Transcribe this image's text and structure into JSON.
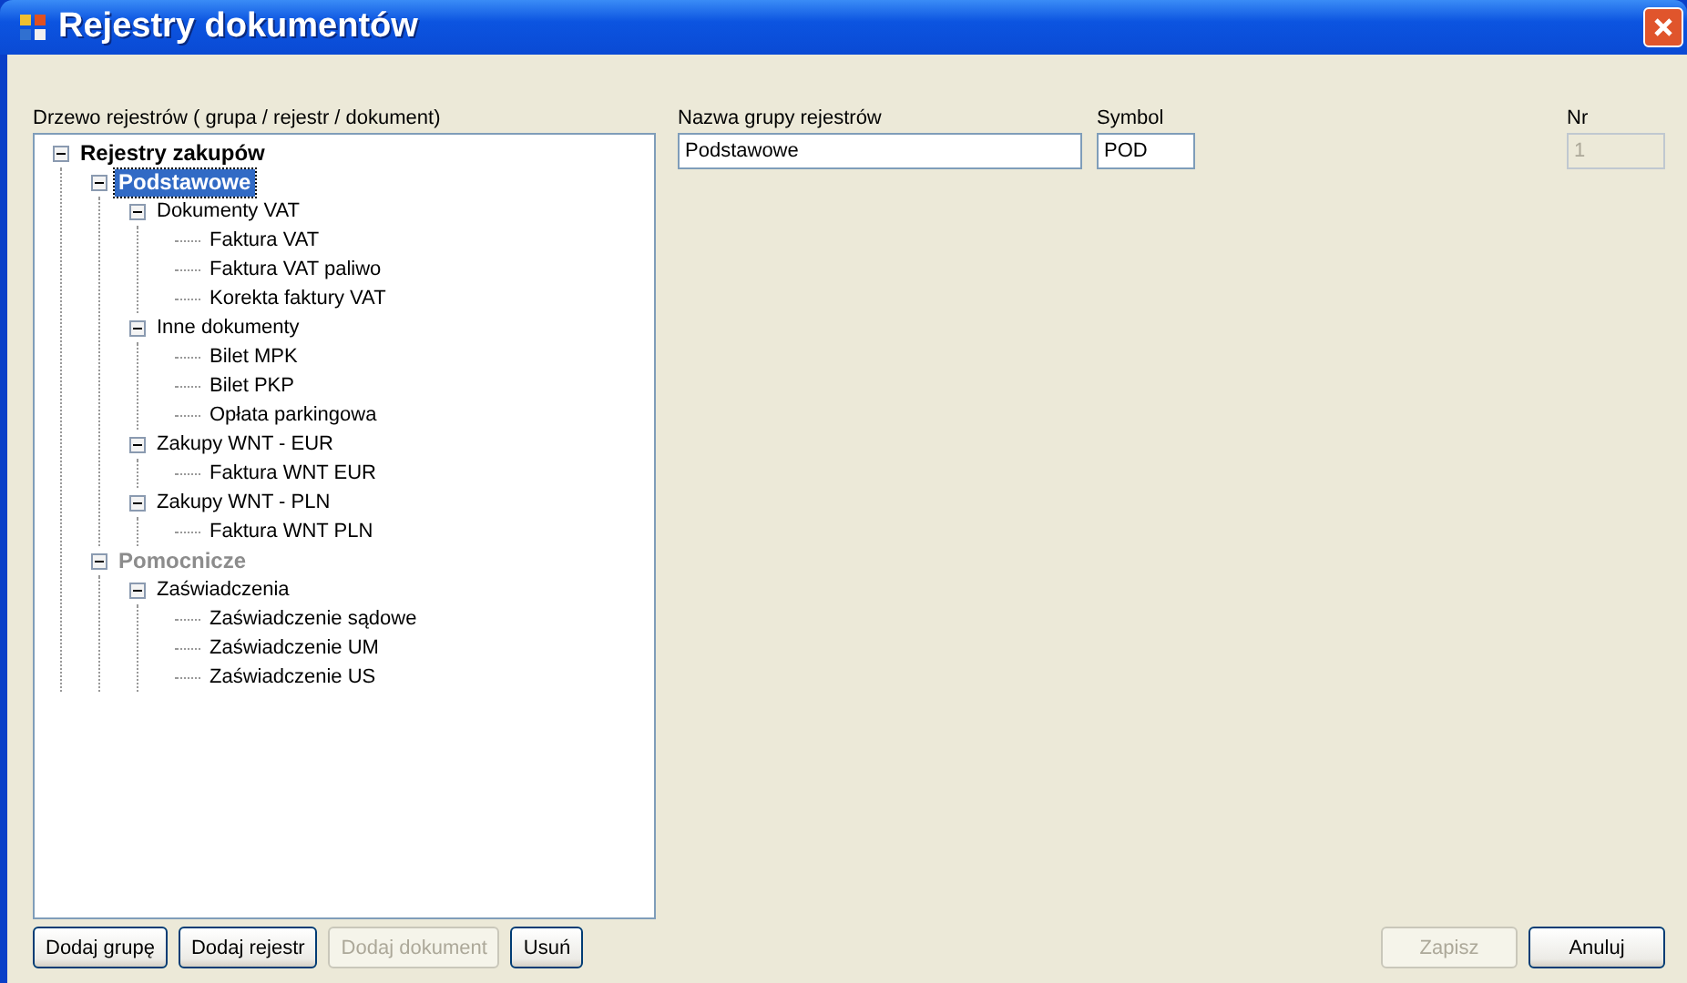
{
  "window": {
    "title": "Rejestry dokumentów"
  },
  "tree": {
    "label": "Drzewo rejestrów ( grupa / rejestr / dokument)",
    "items": [
      {
        "label": "Rejestry zakupów",
        "selected": false,
        "disabled": false,
        "expanded": true,
        "children": [
          {
            "label": "Podstawowe",
            "selected": true,
            "disabled": false,
            "expanded": true,
            "children": [
              {
                "label": "Dokumenty VAT",
                "selected": false,
                "disabled": false,
                "expanded": true,
                "children": [
                  {
                    "label": "Faktura VAT",
                    "selected": false,
                    "disabled": false
                  },
                  {
                    "label": "Faktura VAT paliwo",
                    "selected": false,
                    "disabled": false
                  },
                  {
                    "label": "Korekta faktury VAT",
                    "selected": false,
                    "disabled": false
                  }
                ]
              },
              {
                "label": "Inne dokumenty",
                "selected": false,
                "disabled": false,
                "expanded": true,
                "children": [
                  {
                    "label": "Bilet MPK",
                    "selected": false,
                    "disabled": false
                  },
                  {
                    "label": "Bilet PKP",
                    "selected": false,
                    "disabled": false
                  },
                  {
                    "label": "Opłata parkingowa",
                    "selected": false,
                    "disabled": false
                  }
                ]
              },
              {
                "label": "Zakupy WNT - EUR",
                "selected": false,
                "disabled": false,
                "expanded": true,
                "children": [
                  {
                    "label": "Faktura WNT EUR",
                    "selected": false,
                    "disabled": false
                  }
                ]
              },
              {
                "label": "Zakupy WNT - PLN",
                "selected": false,
                "disabled": false,
                "expanded": true,
                "children": [
                  {
                    "label": "Faktura WNT PLN",
                    "selected": false,
                    "disabled": false
                  }
                ]
              }
            ]
          },
          {
            "label": "Pomocnicze",
            "selected": false,
            "disabled": true,
            "expanded": true,
            "children": [
              {
                "label": "Zaświadczenia",
                "selected": false,
                "disabled": false,
                "expanded": true,
                "children": [
                  {
                    "label": "Zaświadczenie sądowe",
                    "selected": false,
                    "disabled": false
                  },
                  {
                    "label": "Zaświadczenie UM",
                    "selected": false,
                    "disabled": false
                  },
                  {
                    "label": "Zaświadczenie US",
                    "selected": false,
                    "disabled": false
                  }
                ]
              }
            ]
          }
        ]
      }
    ]
  },
  "fields": [
    {
      "label": "Nazwa grupy rejestrów",
      "value": "Podstawowe",
      "disabled": false
    },
    {
      "label": "Symbol",
      "value": "POD",
      "disabled": false
    },
    {
      "label": "Nr",
      "value": "1",
      "disabled": true
    }
  ],
  "left_buttons": [
    {
      "label": "Dodaj grupę",
      "disabled": false
    },
    {
      "label": "Dodaj rejestr",
      "disabled": false
    },
    {
      "label": "Dodaj dokument",
      "disabled": true
    },
    {
      "label": "Usuń",
      "disabled": false
    }
  ],
  "right_buttons": [
    {
      "label": "Zapisz",
      "disabled": true
    },
    {
      "label": "Anuluj",
      "disabled": false
    }
  ]
}
